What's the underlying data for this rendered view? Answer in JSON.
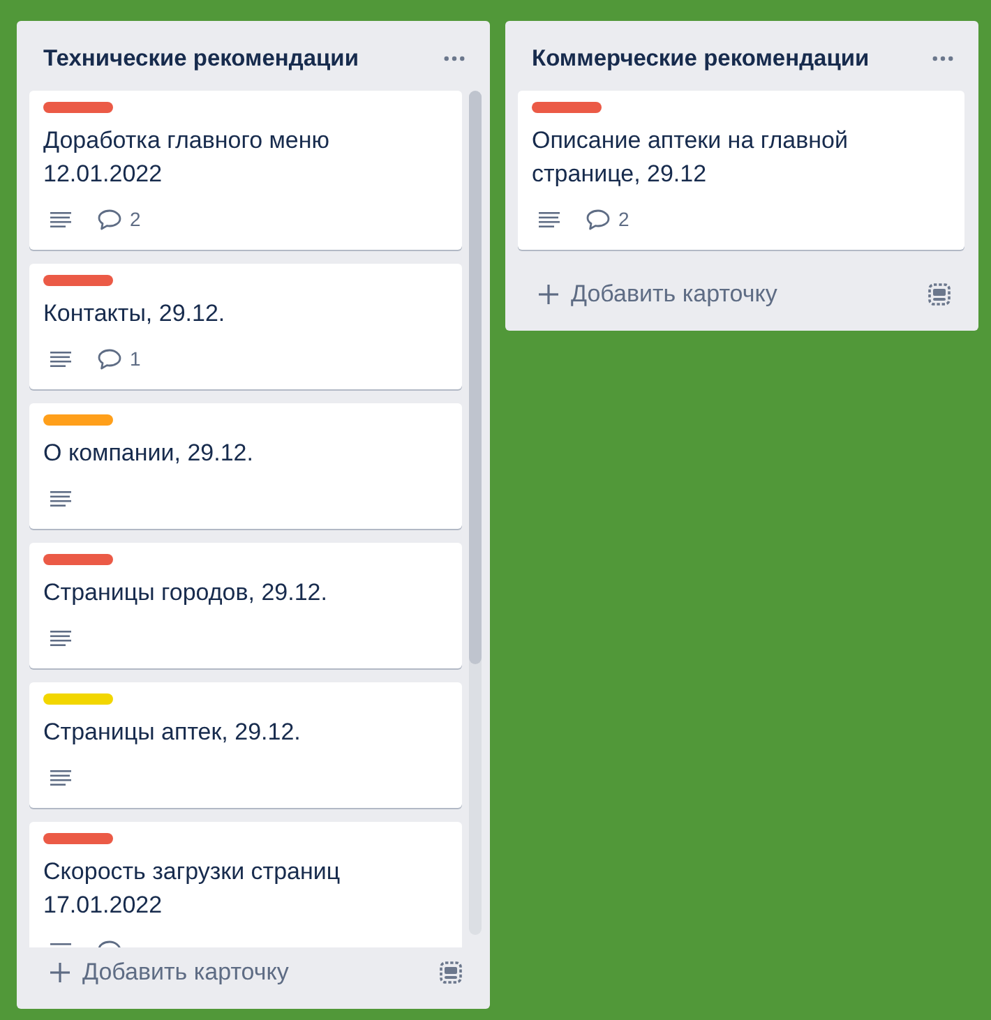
{
  "board": {
    "lists": [
      {
        "title": "Технические рекомендации",
        "scrollbar": true,
        "cards": [
          {
            "color": "#eb5a46",
            "title": "Доработка главного меню 12.01.2022",
            "badges": [
              {
                "kind": "description"
              },
              {
                "kind": "comments",
                "count": "2"
              }
            ]
          },
          {
            "color": "#eb5a46",
            "title": "Контакты, 29.12.",
            "badges": [
              {
                "kind": "description"
              },
              {
                "kind": "comments",
                "count": "1"
              }
            ]
          },
          {
            "color": "#ff9f1a",
            "title": "О компании, 29.12.",
            "badges": [
              {
                "kind": "description"
              }
            ]
          },
          {
            "color": "#eb5a46",
            "title": "Страницы городов, 29.12.",
            "badges": [
              {
                "kind": "description"
              }
            ]
          },
          {
            "color": "#f2d600",
            "title": "Страницы аптек, 29.12.",
            "badges": [
              {
                "kind": "description"
              }
            ]
          },
          {
            "color": "#eb5a46",
            "title": "Скорость загрузки страниц 17.01.2022",
            "badges": [
              {
                "kind": "description"
              },
              {
                "kind": "comments"
              }
            ]
          }
        ],
        "add_card": "Добавить карточку"
      },
      {
        "title": "Коммерческие рекомендации",
        "scrollbar": false,
        "cards": [
          {
            "color": "#eb5a46",
            "title": "Описание аптеки на главной странице, 29.12",
            "badges": [
              {
                "kind": "description"
              },
              {
                "kind": "comments",
                "count": "2"
              }
            ]
          }
        ],
        "add_card": "Добавить карточку"
      }
    ]
  }
}
